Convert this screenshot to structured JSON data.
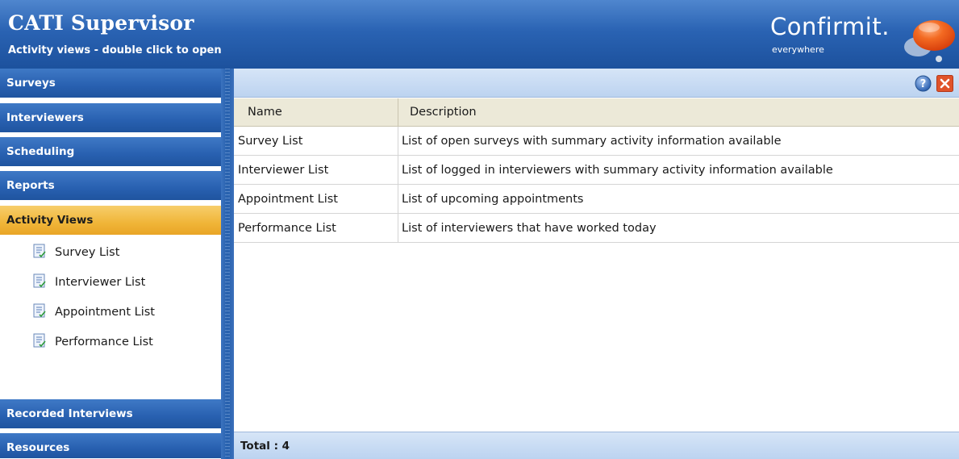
{
  "header": {
    "title": "CATI Supervisor",
    "subtitle": "Activity views - double click to open",
    "brand_name": "Confirmit.",
    "brand_tagline": "everywhere"
  },
  "colors": {
    "header_blue": "#2a63b3",
    "active_orange": "#f0b538",
    "brand_orange": "#f06a1a"
  },
  "sidebar": {
    "items": [
      {
        "label": "Surveys"
      },
      {
        "label": "Interviewers"
      },
      {
        "label": "Scheduling"
      },
      {
        "label": "Reports"
      },
      {
        "label": "Activity Views",
        "active": true
      },
      {
        "label": "Recorded Interviews"
      },
      {
        "label": "Resources"
      }
    ],
    "sub_items": [
      {
        "label": "Survey List",
        "icon": "list-document-icon"
      },
      {
        "label": "Interviewer List",
        "icon": "list-document-icon"
      },
      {
        "label": "Appointment List",
        "icon": "list-document-icon"
      },
      {
        "label": "Performance List",
        "icon": "list-document-icon"
      }
    ]
  },
  "toolbar": {
    "help_icon": "help-icon",
    "close_icon": "close-icon"
  },
  "table": {
    "columns": [
      "Name",
      "Description"
    ],
    "rows": [
      {
        "name": "Survey List",
        "description": "List of open surveys with summary activity information available"
      },
      {
        "name": "Interviewer List",
        "description": "List of logged in interviewers with summary activity information available"
      },
      {
        "name": "Appointment List",
        "description": "List of upcoming appointments"
      },
      {
        "name": "Performance List",
        "description": "List of interviewers that have worked today"
      }
    ]
  },
  "footer": {
    "total": "Total : 4"
  }
}
